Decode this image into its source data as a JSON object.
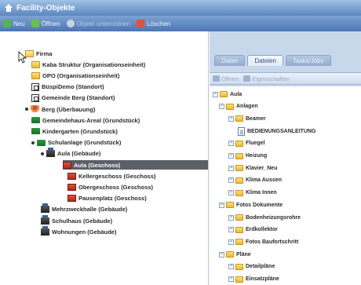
{
  "window": {
    "title": "Facility-Objekte"
  },
  "toolbar": {
    "new_label": "Neu",
    "open_label": "Öffnen",
    "delete_rel_label": "Objekt unterordnen",
    "delete_label": "Löschen"
  },
  "left_tree": [
    {
      "label": "Firma",
      "icon": "folder-open-icon",
      "level": 0
    },
    {
      "label": "Kaba Struktur (Organisationseinheit)",
      "icon": "folder-icon",
      "level": 1
    },
    {
      "label": "OPO (Organisationseinheit)",
      "icon": "folder-icon",
      "level": 1
    },
    {
      "label": "BüspiDemo (Standort)",
      "icon": "site-icon",
      "level": 1
    },
    {
      "label": "Gemeinde Berg (Standort)",
      "icon": "site-icon",
      "level": 1
    },
    {
      "label": "Berg (Überbauung)",
      "icon": "person-icon",
      "level": 2
    },
    {
      "label": "Gemeindehaus-Areal (Grundstück)",
      "icon": "lot-icon",
      "level": 3
    },
    {
      "label": "Kindergarten (Grundstück)",
      "icon": "lot-icon",
      "level": 3
    },
    {
      "label": "Schulanlage (Grundstück)",
      "icon": "lot-icon",
      "level": 3
    },
    {
      "label": "Aula (Gebäude)",
      "icon": "building-icon",
      "level": 4
    },
    {
      "label": "Aula (Geschoss)",
      "icon": "floor-icon",
      "level": 5,
      "selected": true
    },
    {
      "label": "Kellergeschoss (Geschoss)",
      "icon": "floor-icon",
      "level": 5
    },
    {
      "label": "Obergeschoss (Geschoss)",
      "icon": "floor-icon",
      "level": 5
    },
    {
      "label": "Pausenplatz (Geschoss)",
      "icon": "floor-icon",
      "level": 5
    },
    {
      "label": "Mehrzweckhalle (Gebäude)",
      "icon": "building-icon",
      "level": 4
    },
    {
      "label": "Schulhaus (Gebäude)",
      "icon": "building-icon",
      "level": 4
    },
    {
      "label": "Wohnungen (Gebäude)",
      "icon": "building-icon",
      "level": 4
    }
  ],
  "right_tabs": [
    {
      "label": "Daten",
      "active": false
    },
    {
      "label": "Dateien",
      "active": true
    },
    {
      "label": "Tasks/Jobs",
      "active": false
    }
  ],
  "sub_toolbar": {
    "open_label": "Öffnen",
    "props_label": "Eigenschaften"
  },
  "file_tree": [
    {
      "label": "Aula",
      "icon": "folder-icon",
      "level": 0
    },
    {
      "label": "Anlagen",
      "icon": "folder-icon",
      "level": 1
    },
    {
      "label": "Beamer",
      "icon": "folder-icon",
      "level": 2
    },
    {
      "label": "BEDIENUNGSANLEITUNG",
      "icon": "document-icon",
      "level": 3
    },
    {
      "label": "Fluegel",
      "icon": "folder-icon",
      "level": 2
    },
    {
      "label": "Heizung",
      "icon": "folder-icon",
      "level": 2
    },
    {
      "label": "Klavier_Neu",
      "icon": "folder-icon",
      "level": 2
    },
    {
      "label": "Klima Aussen",
      "icon": "folder-icon",
      "level": 2
    },
    {
      "label": "Klima Innen",
      "icon": "folder-icon",
      "level": 2
    },
    {
      "label": "Fotos Dokumente",
      "icon": "folder-icon",
      "level": 1
    },
    {
      "label": "Bodenheizungsrohre",
      "icon": "folder-icon",
      "level": 2
    },
    {
      "label": "Erdkollektor",
      "icon": "folder-icon",
      "level": 2
    },
    {
      "label": "Fotos Baufortschritt",
      "icon": "folder-icon",
      "level": 2
    },
    {
      "label": "Pläne",
      "icon": "folder-icon",
      "level": 1
    },
    {
      "label": "Detailpläne",
      "icon": "folder-icon",
      "level": 2
    },
    {
      "label": "Einsatzpläne",
      "icon": "folder-icon",
      "level": 2
    }
  ]
}
